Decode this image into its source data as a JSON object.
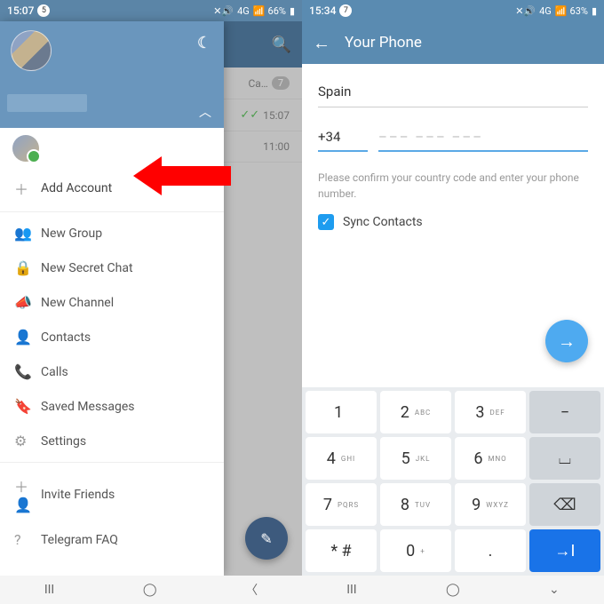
{
  "left": {
    "status": {
      "time": "15:07",
      "notif_count": "5",
      "net": "4G",
      "battery": "66%"
    },
    "chatlist": {
      "row1_name": "Ca…",
      "row1_count": "7",
      "row2_time": "15:07",
      "row3_time": "11:00"
    },
    "drawer": {
      "add_account": "Add Account",
      "items": [
        "New Group",
        "New Secret Chat",
        "New Channel",
        "Contacts",
        "Calls",
        "Saved Messages",
        "Settings"
      ],
      "footer": [
        "Invite Friends",
        "Telegram FAQ"
      ]
    }
  },
  "right": {
    "status": {
      "time": "15:34",
      "notif_count": "7",
      "net": "4G",
      "battery": "63%"
    },
    "title": "Your Phone",
    "country": "Spain",
    "code": "+34",
    "placeholder": "––– –––  –––",
    "hint": "Please confirm your country code and enter your phone number.",
    "sync_label": "Sync Contacts",
    "keypad": {
      "r0": [
        {
          "d": "1",
          "s": ""
        },
        {
          "d": "2",
          "s": "ABC"
        },
        {
          "d": "3",
          "s": "DEF"
        }
      ],
      "r1": [
        {
          "d": "4",
          "s": "GHI"
        },
        {
          "d": "5",
          "s": "JKL"
        },
        {
          "d": "6",
          "s": "MNO"
        }
      ],
      "r2": [
        {
          "d": "7",
          "s": "PQRS"
        },
        {
          "d": "8",
          "s": "TUV"
        },
        {
          "d": "9",
          "s": "WXYZ"
        }
      ],
      "r3": [
        {
          "d": "* #",
          "s": ""
        },
        {
          "d": "0",
          "s": "+"
        },
        {
          "d": ".",
          "s": ""
        }
      ],
      "minus": "−",
      "space": "⌴",
      "backspace": "⌫",
      "enter": "→I"
    }
  }
}
